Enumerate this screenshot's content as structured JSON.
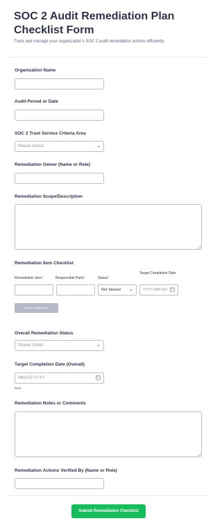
{
  "form": {
    "title": "SOC 2 Audit Remediation Plan Checklist Form",
    "subtitle": "Track and manage your organization's SOC 2 audit remediation actions efficiently."
  },
  "fields": {
    "org_name": {
      "label": "Organization Name",
      "value": ""
    },
    "audit_period": {
      "label": "Audit Period or Date",
      "value": ""
    },
    "criteria_area": {
      "label": "SOC 2 Trust Service Criteria Area",
      "placeholder": "Please Select"
    },
    "owner": {
      "label": "Remediation Owner (Name or Role)",
      "value": ""
    },
    "scope": {
      "label": "Remediation Scope/Description",
      "value": ""
    },
    "overall_status": {
      "label": "Overall Remediation Status",
      "placeholder": "Please Select"
    },
    "target_date": {
      "label": "Target Completion Date (Overall)",
      "placeholder": "MM-DD-YYYY",
      "sublabel": "Date"
    },
    "notes": {
      "label": "Remediation Notes or Comments",
      "value": ""
    },
    "verified_by": {
      "label": "Remediation Actions Verified By (Name or Role)",
      "value": ""
    }
  },
  "checklist": {
    "label": "Remediation Item Checklist",
    "columns": {
      "item": "Remediation Item",
      "party": "Responsible Party",
      "status": "Status",
      "date": "Target Completion Date"
    },
    "required_marker": "*",
    "row": {
      "status_value": "Not Started",
      "date_placeholder": "YYYY-MM-DD"
    },
    "add_label": "Add Remediation Item"
  },
  "submit_label": "Submit Remediation Checklist",
  "colors": {
    "submit": "#18bd5b",
    "required": "#f23a3c",
    "add_button": "#b5b9c6"
  }
}
